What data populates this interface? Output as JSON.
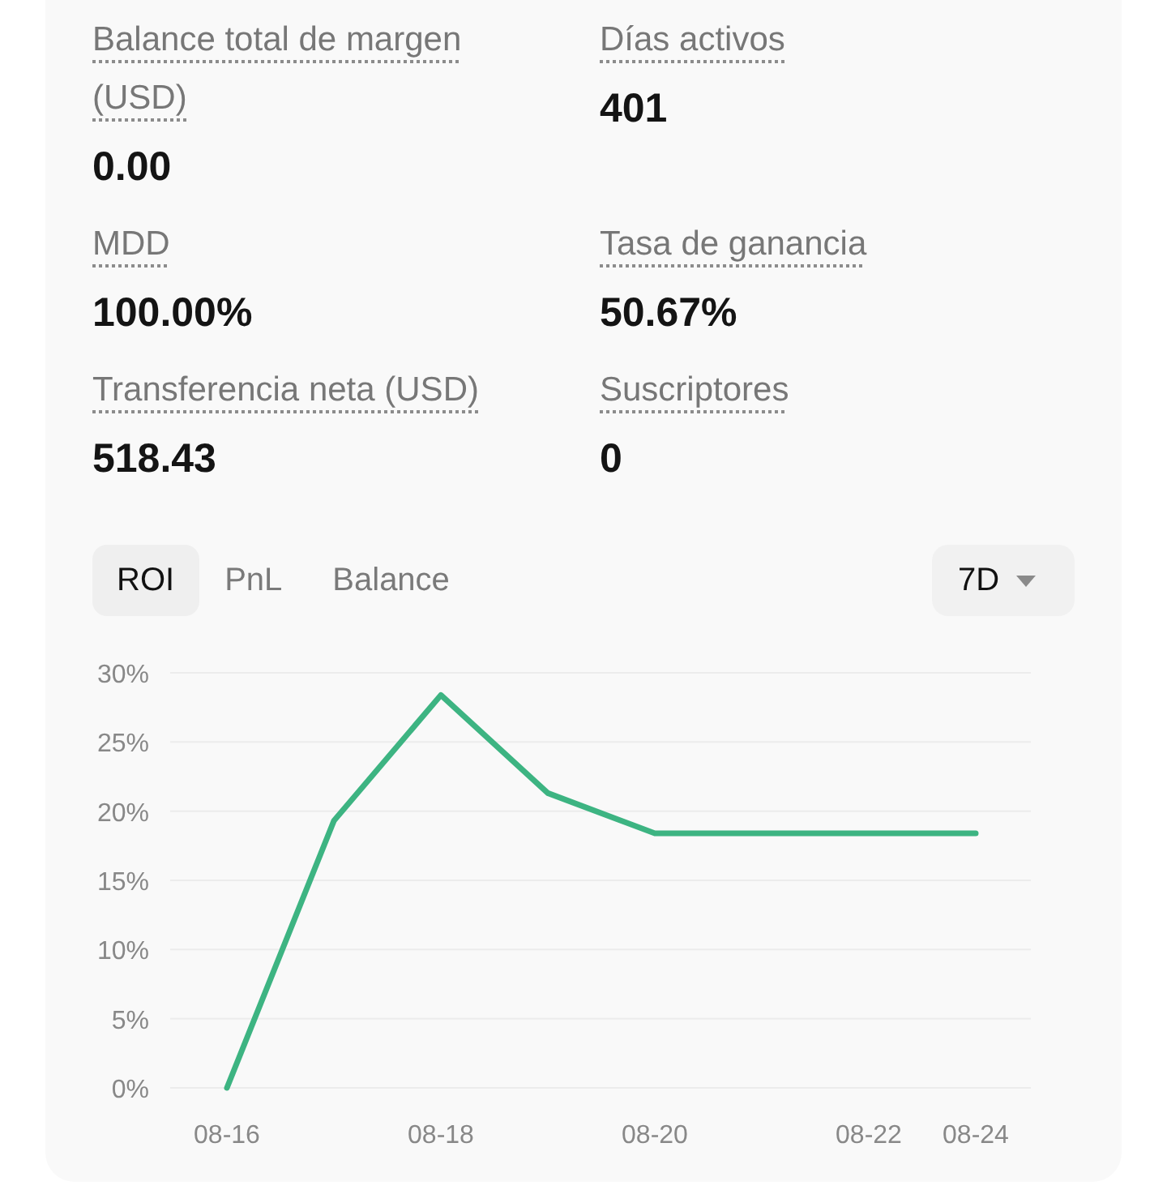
{
  "stats": [
    {
      "label": "Balance total de margen (USD)",
      "value": "0.00"
    },
    {
      "label": "Días activos",
      "value": "401"
    },
    {
      "label": "MDD",
      "value": "100.00%"
    },
    {
      "label": "Tasa de ganancia",
      "value": "50.67%"
    },
    {
      "label": "Transferencia neta (USD)",
      "value": "518.43"
    },
    {
      "label": "Suscriptores",
      "value": "0"
    }
  ],
  "chart_tabs": [
    {
      "label": "ROI",
      "selected": true
    },
    {
      "label": "PnL",
      "selected": false
    },
    {
      "label": "Balance",
      "selected": false
    }
  ],
  "period_dropdown": {
    "value": "7D"
  },
  "chart": {
    "chart_data": {
      "type": "line",
      "grid": true,
      "categories": [
        "08-16",
        null,
        "08-18",
        null,
        "08-20",
        null,
        "08-22",
        "08-24"
      ],
      "series": [
        {
          "color": "#3db482",
          "values": [
            0,
            19.3,
            28.4,
            21.3,
            18.4,
            18.4,
            18.4,
            18.4
          ]
        }
      ],
      "ylim": [
        0,
        30
      ],
      "yticks": [
        {
          "value": 0,
          "label": "0%"
        },
        {
          "value": 5,
          "label": "5%"
        },
        {
          "value": 10,
          "label": "10%"
        },
        {
          "value": 15,
          "label": "15%"
        },
        {
          "value": 20,
          "label": "20%"
        },
        {
          "value": 25,
          "label": "25%"
        },
        {
          "value": 30,
          "label": "30%"
        }
      ]
    }
  }
}
